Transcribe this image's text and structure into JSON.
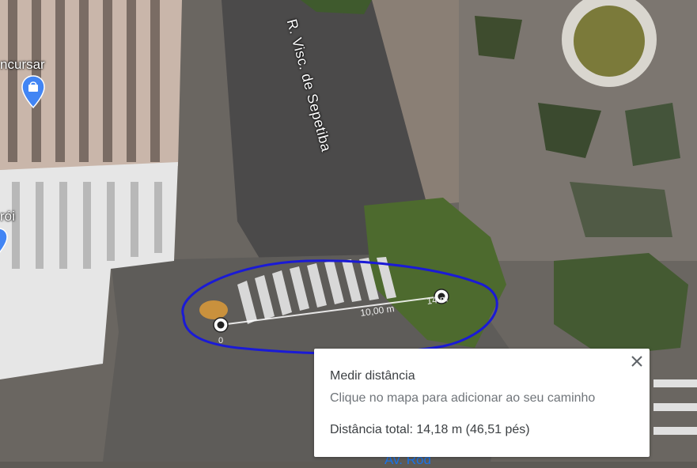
{
  "map": {
    "labels": {
      "poi_top": "ncursar",
      "poi_mid": "rói",
      "street": "R. Visc. de Sepetiba",
      "bottom_partial": "Av. Rod"
    },
    "icons": {
      "poi_top_icon": "shopping-bag-pin-icon",
      "poi_mid_icon": "blue-pin-icon"
    },
    "measure": {
      "start_label": "0",
      "mid_label": "10,00 m",
      "end_label": "14 m"
    }
  },
  "panel": {
    "title": "Medir distância",
    "hint": "Clique no mapa para adicionar ao seu caminho",
    "total": "Distância total: 14,18 m (46,51 pés)"
  },
  "colors": {
    "annotation": "#1a1ad6",
    "pin_blue": "#4285f4",
    "panel_bg": "#ffffff"
  }
}
